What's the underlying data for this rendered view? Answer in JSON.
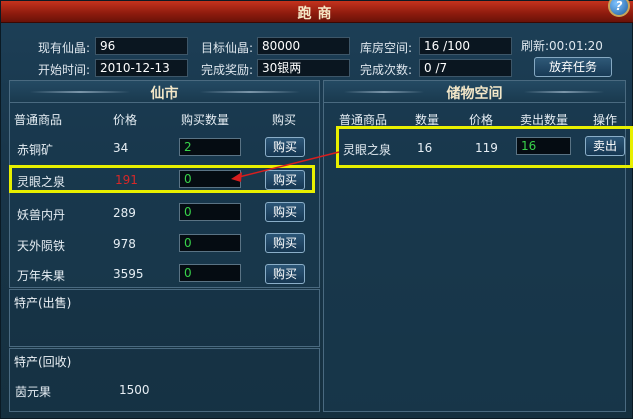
{
  "window": {
    "title": "跑商",
    "help": "?"
  },
  "info": {
    "current_crystal_label": "现有仙晶:",
    "current_crystal_value": "96",
    "target_crystal_label": "目标仙晶:",
    "target_crystal_value": "80000",
    "storage_label": "库房空间:",
    "storage_value": "16 /100",
    "refresh_label": "刷新:",
    "refresh_value": "00:01:20",
    "start_time_label": "开始时间:",
    "start_time_value": "2010-12-13",
    "reward_label": "完成奖励:",
    "reward_value": "30银两",
    "times_label": "完成次数:",
    "times_value": "0   /7",
    "abandon_button": "放弃任务"
  },
  "market": {
    "title": "仙市",
    "headers": {
      "item": "普通商品",
      "price": "价格",
      "qty": "购买数量",
      "action": "购买"
    },
    "rows": [
      {
        "name": "赤铜矿",
        "price": "34",
        "qty": "2",
        "button": "购买"
      },
      {
        "name": "灵眼之泉",
        "price": "191",
        "qty": "0",
        "button": "购买"
      },
      {
        "name": "妖兽内丹",
        "price": "289",
        "qty": "0",
        "button": "购买"
      },
      {
        "name": "天外陨铁",
        "price": "978",
        "qty": "0",
        "button": "购买"
      },
      {
        "name": "万年朱果",
        "price": "3595",
        "qty": "0",
        "button": "购买"
      }
    ],
    "special_sell_title": "特产(出售)",
    "special_buy_title": "特产(回收)",
    "special_buy_item": {
      "name": "茵元果",
      "price": "1500"
    }
  },
  "storage": {
    "title": "储物空间",
    "headers": {
      "item": "普通商品",
      "count": "数量",
      "price": "价格",
      "qty": "卖出数量",
      "action": "操作"
    },
    "rows": [
      {
        "name": "灵眼之泉",
        "count": "16",
        "price": "119",
        "qty": "16",
        "button": "卖出"
      }
    ]
  },
  "colors": {
    "highlight": "#e8f000",
    "arrow": "#d81e1e",
    "price_red": "#d62828",
    "qty_green": "#38d24a"
  }
}
